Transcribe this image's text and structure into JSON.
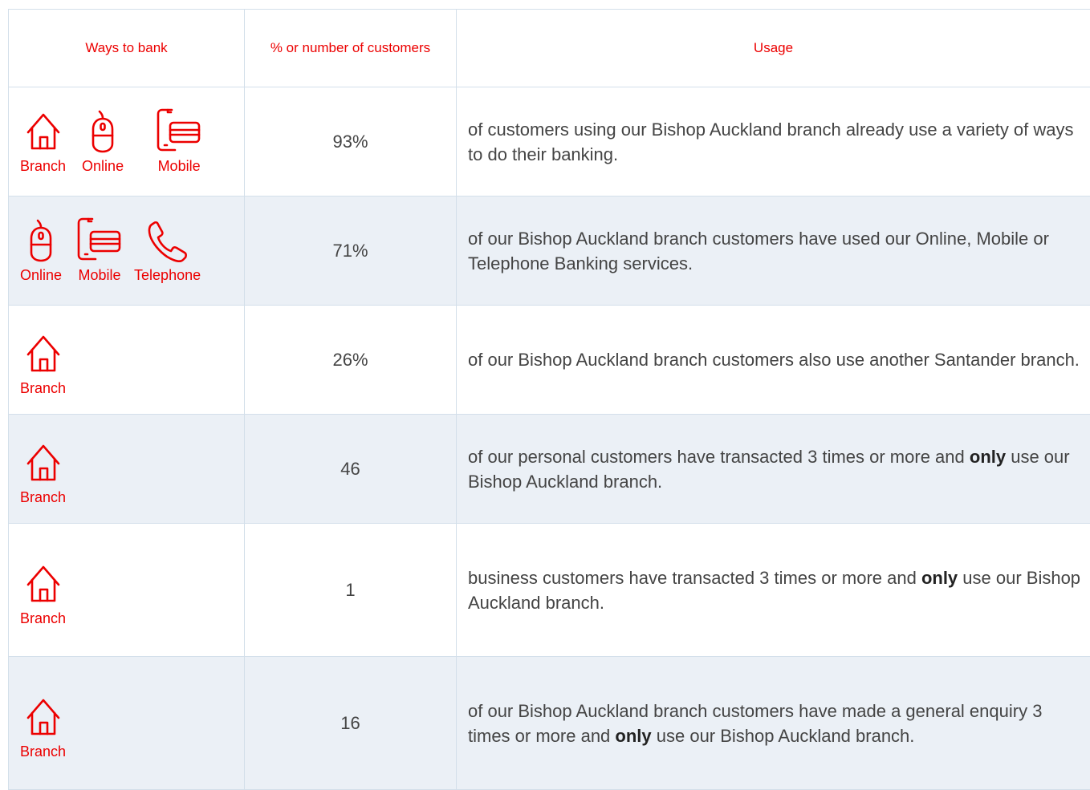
{
  "headers": {
    "ways": "Ways to bank",
    "percent": "% or number of customers",
    "usage": "Usage"
  },
  "colors": {
    "accent": "#ec0000",
    "row_alt": "#ebf0f6",
    "border": "#d3dfea",
    "text": "#444444"
  },
  "rows": [
    {
      "icons": [
        {
          "icon": "house-icon",
          "label": "Branch"
        },
        {
          "icon": "mouse-icon",
          "label": "Online"
        },
        {
          "icon": "mobile-icon",
          "label": "Mobile"
        }
      ],
      "value": "93%",
      "usage": {
        "pre": "of customers using our Bishop Auckland branch already use a variety of ways to do their banking.",
        "bold": "",
        "post": ""
      }
    },
    {
      "icons": [
        {
          "icon": "mouse-icon",
          "label": "Online"
        },
        {
          "icon": "mobile-icon",
          "label": "Mobile"
        },
        {
          "icon": "phone-icon",
          "label": "Telephone"
        }
      ],
      "value": "71%",
      "usage": {
        "pre": "of our Bishop Auckland branch customers have used our Online, Mobile or Telephone Banking services.",
        "bold": "",
        "post": ""
      }
    },
    {
      "icons": [
        {
          "icon": "house-icon",
          "label": "Branch"
        }
      ],
      "value": "26%",
      "usage": {
        "pre": "of our Bishop Auckland branch customers also use another Santander branch.",
        "bold": "",
        "post": ""
      }
    },
    {
      "icons": [
        {
          "icon": "house-icon",
          "label": "Branch"
        }
      ],
      "value": "46",
      "usage": {
        "pre": "of our personal customers have transacted 3 times or more and ",
        "bold": "only",
        "post": " use our Bishop Auckland branch."
      }
    },
    {
      "icons": [
        {
          "icon": "house-icon",
          "label": "Branch"
        }
      ],
      "value": "1",
      "usage": {
        "pre": "business customers have transacted 3 times or more and ",
        "bold": "only",
        "post": " use our Bishop Auckland branch."
      }
    },
    {
      "icons": [
        {
          "icon": "house-icon",
          "label": "Branch"
        }
      ],
      "value": "16",
      "usage": {
        "pre": "of our Bishop Auckland branch customers have made a general enquiry 3 times or more and ",
        "bold": "only",
        "post": " use our Bishop Auckland branch."
      }
    }
  ]
}
